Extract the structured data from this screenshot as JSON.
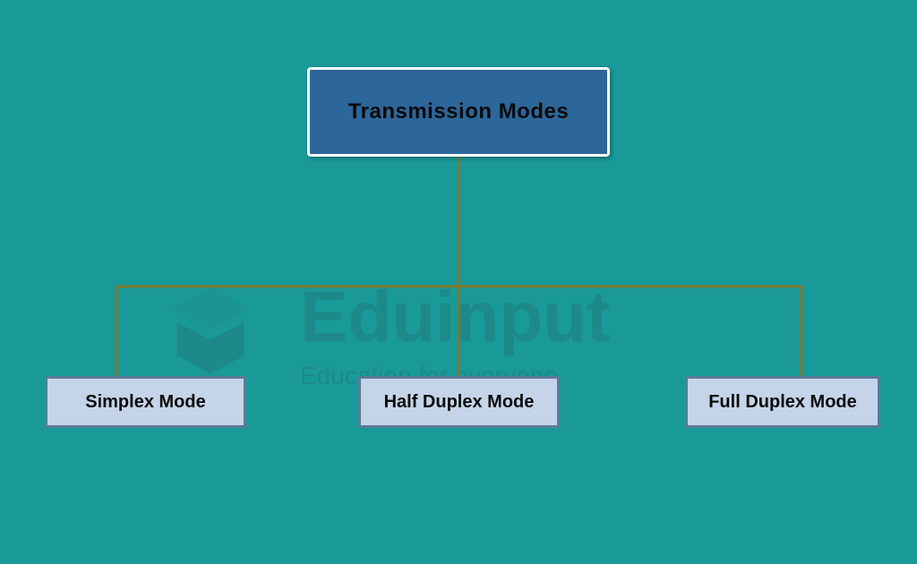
{
  "diagram": {
    "root": {
      "label": "Transmission Modes"
    },
    "children": [
      {
        "label": "Simplex Mode"
      },
      {
        "label": "Half Duplex Mode"
      },
      {
        "label": "Full Duplex Mode"
      }
    ]
  },
  "watermark": {
    "title": "Eduinput",
    "subtitle": "Education for everyone"
  },
  "colors": {
    "background": "#1a9999",
    "rootBox": "#2d6699",
    "childBox": "#c5d4e8",
    "connector": "#7a7a2d"
  }
}
